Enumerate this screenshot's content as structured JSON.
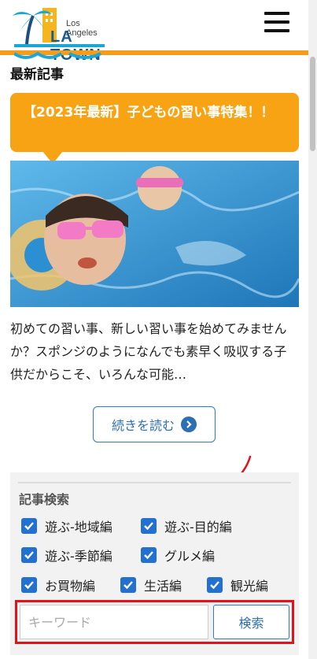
{
  "header": {
    "logo_small": "Los Angeles",
    "logo_big": "LA TOWN"
  },
  "latest": {
    "title": "最新記事",
    "article_title": "【2023年最新】子どもの習い事特集！！",
    "excerpt": "初めての習い事、新しい習い事を始めてみませんか？スポンジのようになんでも素早く吸収する子供だからこそ、いろんな可能…",
    "read_more": "続きを読む"
  },
  "search": {
    "title": "記事検索",
    "categories": [
      {
        "label": "遊ぶ-地域編",
        "checked": true
      },
      {
        "label": "遊ぶ-目的編",
        "checked": true
      },
      {
        "label": "遊ぶ-季節編",
        "checked": true
      },
      {
        "label": "グルメ編",
        "checked": true
      },
      {
        "label": "お買物編",
        "checked": true
      },
      {
        "label": "生活編",
        "checked": true
      },
      {
        "label": "観光編",
        "checked": true
      }
    ],
    "placeholder": "キーワード",
    "button": "検索"
  },
  "colors": {
    "brand_orange": "#f49d1a",
    "link_blue": "#2c6fb3",
    "checkbox_blue": "#2271d1",
    "highlight_red": "#e3131b"
  }
}
